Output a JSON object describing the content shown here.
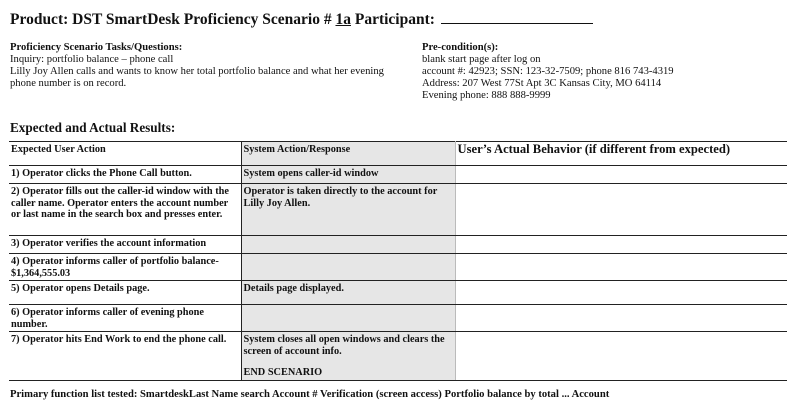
{
  "header": {
    "title_prefix": "Product: DST SmartDesk Proficiency Scenario #",
    "scenario_number": "1a",
    "title_suffix": "Participant:"
  },
  "tasks": {
    "heading": "Proficiency Scenario Tasks/Questions:",
    "inquiry": "Inquiry: portfolio balance – phone call",
    "description": "Lilly Joy Allen calls and wants to know her total portfolio balance and what her evening phone number is on record."
  },
  "preconditions": {
    "heading": "Pre-condition(s):",
    "lines": [
      "blank start page after log on",
      "account #: 42923; SSN: 123-32-7509; phone 816 743-4319",
      "Address: 207 West 77St Apt 3C Kansas City, MO 64114",
      "Evening phone: 888 888-9999"
    ]
  },
  "results": {
    "heading": "Expected and Actual Results:",
    "columns": [
      "Expected User Action",
      "System Action/Response",
      "User’s Actual Behavior (if different from expected)"
    ],
    "rows": [
      {
        "action": "1) Operator clicks the Phone Call button.",
        "response": "System opens caller-id window",
        "actual": ""
      },
      {
        "action": "2) Operator fills out the caller-id window with the caller name.   Operator enters the account number or last name in the search box and presses enter.",
        "response": "Operator is taken directly to the account for Lilly Joy Allen.",
        "actual": ""
      },
      {
        "action": "3) Operator verifies the account information",
        "response": "",
        "actual": ""
      },
      {
        "action": "4)  Operator informs caller of portfolio balance- $1,364,555.03",
        "response": "",
        "actual": ""
      },
      {
        "action": "5)  Operator opens Details page.",
        "response": "Details page displayed.",
        "actual": ""
      },
      {
        "action": "6) Operator informs caller of evening phone number.",
        "response": "",
        "actual": ""
      },
      {
        "action": "7)  Operator hits End Work to end the phone call.",
        "response": "System closes all open windows and clears the screen of account info.",
        "actual": ""
      }
    ],
    "end_label": "END SCENARIO"
  },
  "footer": {
    "text": "Primary function list tested: SmartdeskLast Name search Account # Verification (screen access)  Portfolio balance by total ... Account"
  }
}
